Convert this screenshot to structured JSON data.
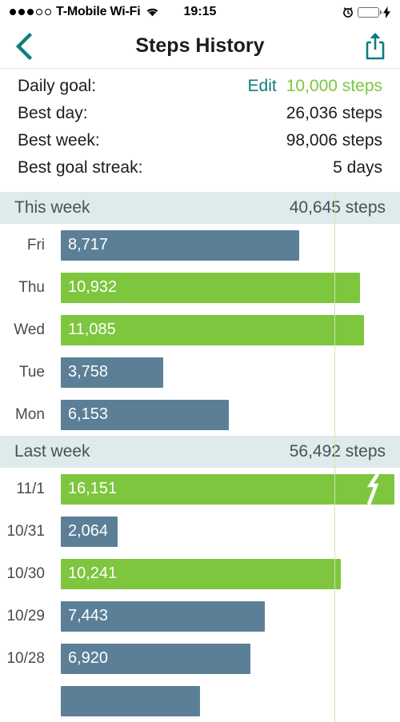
{
  "status_bar": {
    "signal_dots": [
      "filled",
      "filled",
      "filled",
      "hollow",
      "hollow"
    ],
    "carrier": "T-Mobile Wi-Fi",
    "wifi_icon": "wifi-icon",
    "time": "19:15",
    "alarm_icon": "alarm-clock-icon",
    "battery_icon": "battery-icon",
    "charging_icon": "lightning-bolt-icon",
    "battery_color": "#4cd964"
  },
  "nav": {
    "back_icon": "chevron-left-icon",
    "title": "Steps History",
    "share_icon": "share-icon",
    "accent_color": "#0d7d7d"
  },
  "summary": {
    "rows": [
      {
        "label": "Daily goal:",
        "edit": "Edit",
        "value": "10,000 steps",
        "value_color": "#7dc63e"
      },
      {
        "label": "Best day:",
        "value": "26,036 steps"
      },
      {
        "label": "Best week:",
        "value": "98,006 steps"
      },
      {
        "label": "Best goal streak:",
        "value": "5 days"
      }
    ]
  },
  "chart_data": {
    "type": "bar",
    "orientation": "horizontal",
    "title": "Steps History",
    "xlabel": "",
    "ylabel": "",
    "goal_line": 10000,
    "goal_line_color": "#cfe6b5",
    "colors": {
      "goal_met": "#7dc63e",
      "below_goal": "#5b7f96"
    },
    "axis_max": 12400,
    "sections": [
      {
        "name": "This week",
        "total": "40,645 steps",
        "total_value": 40645,
        "categories": [
          "Fri",
          "Thu",
          "Wed",
          "Tue",
          "Mon"
        ],
        "values": [
          8717,
          10932,
          11085,
          3758,
          6153
        ],
        "labels": [
          "8,717",
          "10,932",
          "11,085",
          "3,758",
          "6,153"
        ],
        "goal_met": [
          false,
          true,
          true,
          false,
          false
        ],
        "truncated": [
          false,
          false,
          false,
          false,
          false
        ]
      },
      {
        "name": "Last week",
        "total": "56,492 steps",
        "total_value": 56492,
        "categories": [
          "11/1",
          "10/31",
          "10/30",
          "10/29",
          "10/28",
          ""
        ],
        "values": [
          16151,
          2064,
          10241,
          7443,
          6920,
          5100
        ],
        "labels": [
          "16,151",
          "2,064",
          "10,241",
          "7,443",
          "6,920",
          ""
        ],
        "goal_met": [
          true,
          false,
          true,
          false,
          false,
          false
        ],
        "truncated": [
          true,
          false,
          false,
          false,
          false,
          false
        ]
      }
    ]
  }
}
